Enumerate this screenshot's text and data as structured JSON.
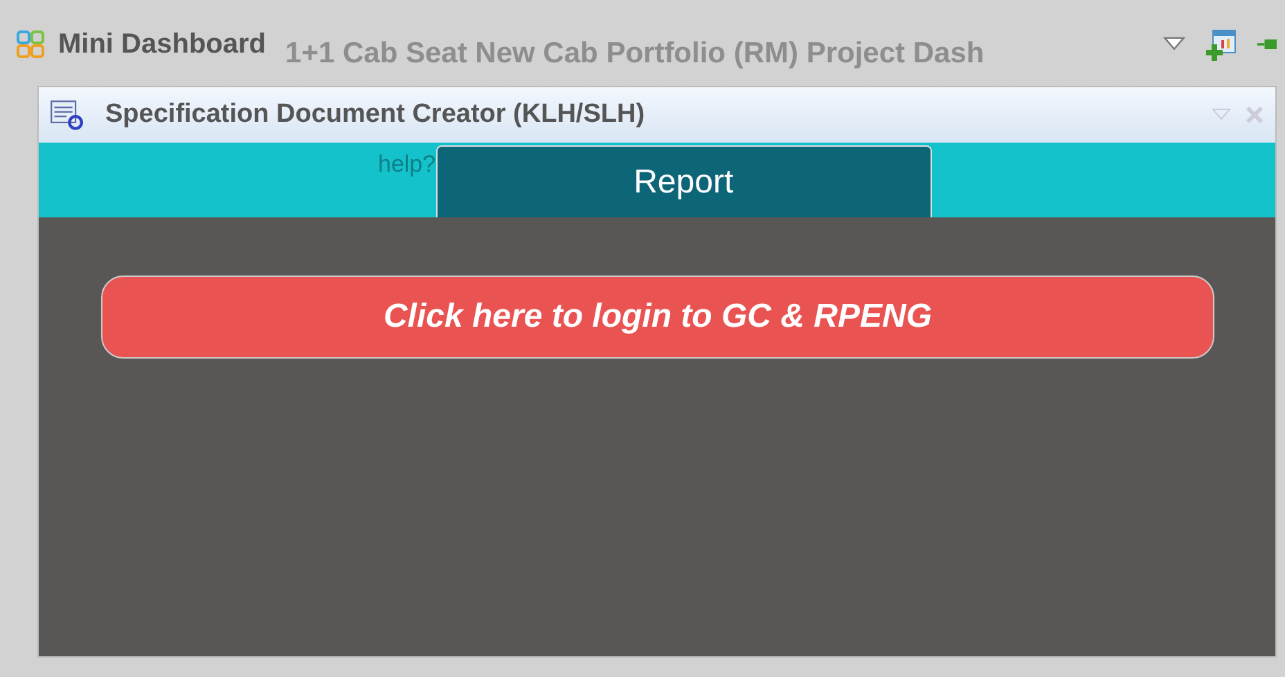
{
  "dashboard": {
    "title": "Mini Dashboard",
    "background_title": "1+1 Cab Seat New Cab Portfolio (RM) Project Dash"
  },
  "panel": {
    "title": "Specification Document Creator (KLH/SLH)",
    "help_link": "help?",
    "tabs": [
      {
        "label": "Report",
        "selected": true
      }
    ],
    "login_button": "Click here to login to GC & RPENG"
  }
}
